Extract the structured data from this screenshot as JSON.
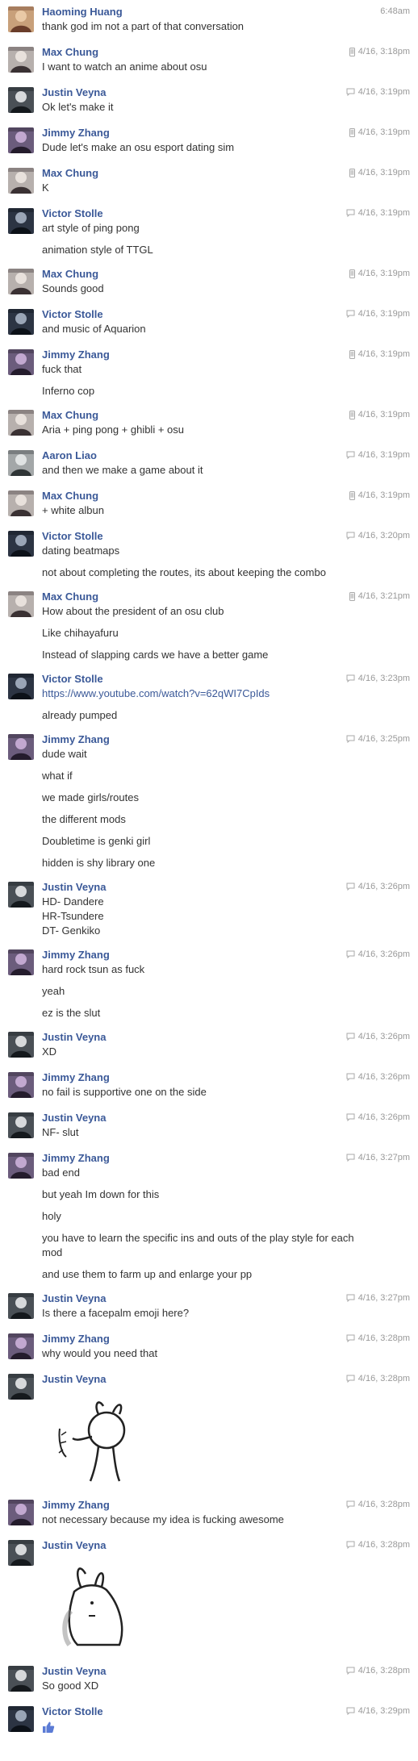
{
  "messages": [
    {
      "sender": "Haoming Huang",
      "time": "6:48am",
      "source": "none",
      "avatar": "hh",
      "lines": [
        "thank god im not a part of that conversation"
      ]
    },
    {
      "sender": "Max Chung",
      "time": "4/16, 3:18pm",
      "source": "mobile",
      "avatar": "mc",
      "lines": [
        "I want to watch an anime about osu"
      ]
    },
    {
      "sender": "Justin Veyna",
      "time": "4/16, 3:19pm",
      "source": "chat",
      "avatar": "jv",
      "lines": [
        "Ok let's make it"
      ]
    },
    {
      "sender": "Jimmy Zhang",
      "time": "4/16, 3:19pm",
      "source": "mobile",
      "avatar": "jz",
      "lines": [
        "Dude let's make an osu esport dating sim"
      ]
    },
    {
      "sender": "Max Chung",
      "time": "4/16, 3:19pm",
      "source": "mobile",
      "avatar": "mc",
      "lines": [
        "K"
      ]
    },
    {
      "sender": "Victor Stolle",
      "time": "4/16, 3:19pm",
      "source": "chat",
      "avatar": "vs",
      "lines": [
        "art style of ping pong",
        "animation style of TTGL"
      ]
    },
    {
      "sender": "Max Chung",
      "time": "4/16, 3:19pm",
      "source": "mobile",
      "avatar": "mc",
      "lines": [
        "Sounds good"
      ]
    },
    {
      "sender": "Victor Stolle",
      "time": "4/16, 3:19pm",
      "source": "chat",
      "avatar": "vs",
      "lines": [
        "and music of Aquarion"
      ]
    },
    {
      "sender": "Jimmy Zhang",
      "time": "4/16, 3:19pm",
      "source": "mobile",
      "avatar": "jz",
      "lines": [
        "fuck that",
        "Inferno cop"
      ]
    },
    {
      "sender": "Max Chung",
      "time": "4/16, 3:19pm",
      "source": "mobile",
      "avatar": "mc",
      "lines": [
        "Aria + ping pong + ghibli + osu"
      ]
    },
    {
      "sender": "Aaron Liao",
      "time": "4/16, 3:19pm",
      "source": "chat",
      "avatar": "al",
      "lines": [
        "and then we make a game about it"
      ]
    },
    {
      "sender": "Max Chung",
      "time": "4/16, 3:19pm",
      "source": "mobile",
      "avatar": "mc",
      "lines": [
        "+ white albun"
      ]
    },
    {
      "sender": "Victor Stolle",
      "time": "4/16, 3:20pm",
      "source": "chat",
      "avatar": "vs",
      "lines": [
        "dating beatmaps",
        "not about completing the routes, its about keeping the combo"
      ]
    },
    {
      "sender": "Max Chung",
      "time": "4/16, 3:21pm",
      "source": "mobile",
      "avatar": "mc",
      "lines": [
        "How about the president of an osu club",
        "Like chihayafuru",
        "Instead of slapping cards we have a better game"
      ]
    },
    {
      "sender": "Victor Stolle",
      "time": "4/16, 3:23pm",
      "source": "chat",
      "avatar": "vs",
      "link": "https://www.youtube.com/watch?v=62qWI7CpIds",
      "lines": [
        "already pumped"
      ]
    },
    {
      "sender": "Jimmy Zhang",
      "time": "4/16, 3:25pm",
      "source": "chat",
      "avatar": "jz",
      "lines": [
        "dude wait",
        "what if",
        "we made girls/routes",
        "the different mods",
        "Doubletime is genki girl",
        "hidden is shy library one"
      ]
    },
    {
      "sender": "Justin Veyna",
      "time": "4/16, 3:26pm",
      "source": "chat",
      "avatar": "jv",
      "lines": [
        "HD- Dandere\nHR-Tsundere\nDT- Genkiko"
      ]
    },
    {
      "sender": "Jimmy Zhang",
      "time": "4/16, 3:26pm",
      "source": "chat",
      "avatar": "jz",
      "lines": [
        "hard rock tsun as fuck",
        "yeah",
        "ez is the slut"
      ]
    },
    {
      "sender": "Justin Veyna",
      "time": "4/16, 3:26pm",
      "source": "chat",
      "avatar": "jv",
      "lines": [
        "XD"
      ]
    },
    {
      "sender": "Jimmy Zhang",
      "time": "4/16, 3:26pm",
      "source": "chat",
      "avatar": "jz",
      "lines": [
        "no fail is supportive one on the side"
      ]
    },
    {
      "sender": "Justin Veyna",
      "time": "4/16, 3:26pm",
      "source": "chat",
      "avatar": "jv",
      "lines": [
        "NF- slut"
      ]
    },
    {
      "sender": "Jimmy Zhang",
      "time": "4/16, 3:27pm",
      "source": "chat",
      "avatar": "jz",
      "lines": [
        "bad end",
        "but yeah Im down for this",
        "holy",
        "you have to learn the specific ins and outs of the play style for each mod",
        "and use them to farm up and enlarge your pp"
      ]
    },
    {
      "sender": "Justin Veyna",
      "time": "4/16, 3:27pm",
      "source": "chat",
      "avatar": "jv",
      "lines": [
        "Is there a facepalm emoji here?"
      ]
    },
    {
      "sender": "Jimmy Zhang",
      "time": "4/16, 3:28pm",
      "source": "chat",
      "avatar": "jz",
      "lines": [
        "why would you need that"
      ]
    },
    {
      "sender": "Justin Veyna",
      "time": "4/16, 3:28pm",
      "source": "chat",
      "avatar": "jv",
      "sticker": "facepalm-sticker",
      "lines": []
    },
    {
      "sender": "Jimmy Zhang",
      "time": "4/16, 3:28pm",
      "source": "chat",
      "avatar": "jz",
      "lines": [
        "not necessary because my idea is fucking awesome"
      ]
    },
    {
      "sender": "Justin Veyna",
      "time": "4/16, 3:28pm",
      "source": "chat",
      "avatar": "jv",
      "sticker": "sulking-sticker",
      "lines": []
    },
    {
      "sender": "Justin Veyna",
      "time": "4/16, 3:28pm",
      "source": "chat",
      "avatar": "jv",
      "lines": [
        "So good XD"
      ]
    },
    {
      "sender": "Victor Stolle",
      "time": "4/16, 3:29pm",
      "source": "chat",
      "avatar": "vs",
      "like": true,
      "lines": []
    }
  ],
  "icons": {
    "mobile": "mobile-phone-icon",
    "chat": "chat-bubble-icon",
    "like": "thumbs-up-icon"
  },
  "colors": {
    "sender": "#3b5998",
    "text": "#333333",
    "time": "#999999",
    "link": "#3b5998"
  }
}
